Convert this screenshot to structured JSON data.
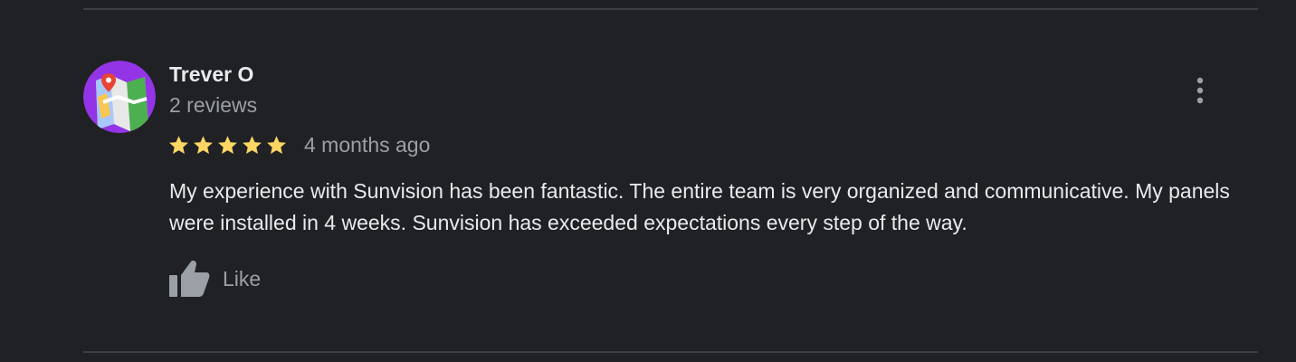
{
  "review": {
    "reviewer_name": "Trever O",
    "review_count": "2 reviews",
    "rating": 5,
    "rating_max": 5,
    "timestamp": "4 months ago",
    "text": "My experience with Sunvision has been fantastic. The entire team is very organized and communicative. My panels were installed in 4 weeks. Sunvision has exceeded expectations every step of the way.",
    "like_label": "Like"
  },
  "icons": {
    "avatar": "map-avatar-icon",
    "star": "star-icon",
    "like": "thumbs-up-icon",
    "more": "more-vert-icon"
  },
  "colors": {
    "background": "#202124",
    "primary_text": "#e8eaed",
    "secondary_text": "#9aa0a6",
    "star": "#fdd663",
    "divider": "#3c4043",
    "avatar_bg": "#9334e6"
  }
}
